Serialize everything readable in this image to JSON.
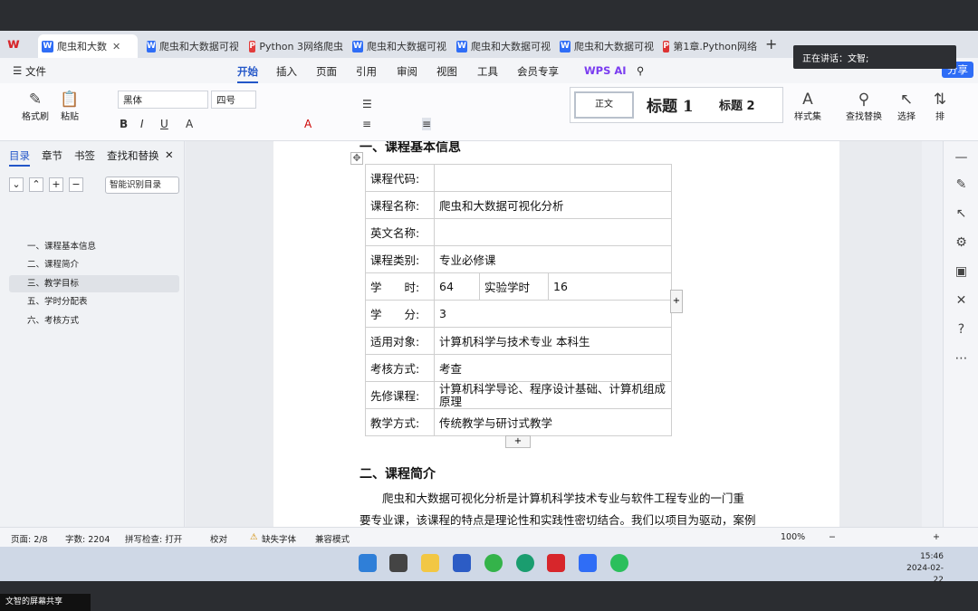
{
  "tabs": [
    {
      "label": "爬虫和大数",
      "icon": "W"
    },
    {
      "label": "爬虫和大数据可视",
      "icon": "W"
    },
    {
      "label": "Python 3网络爬虫",
      "icon": "P"
    },
    {
      "label": "爬虫和大数据可视",
      "icon": "W"
    },
    {
      "label": "爬虫和大数据可视",
      "icon": "W"
    },
    {
      "label": "爬虫和大数据可视",
      "icon": "W"
    },
    {
      "label": "第1章.Python网络",
      "icon": "P"
    }
  ],
  "notice": "正在讲话：文智;",
  "menu": {
    "file": "文件",
    "items": [
      "开始",
      "插入",
      "页面",
      "引用",
      "审阅",
      "视图",
      "工具",
      "会员专享"
    ],
    "ai": "WPS AI",
    "share": "分享"
  },
  "ribbon": {
    "format_painter": "格式刷",
    "paste": "粘贴",
    "font": "黑体",
    "size": "四号",
    "style_normal": "正文",
    "style_h1": "标题 1",
    "style_h2": "标题 2",
    "style_set": "样式集",
    "find_replace": "查找替换",
    "select": "选择",
    "arrange": "排"
  },
  "leftpane": {
    "tabs": [
      "目录",
      "章节",
      "书签",
      "查找和替换"
    ],
    "smart_button": "智能识别目录",
    "toc": [
      "一、课程基本信息",
      "二、课程简介",
      "三、教学目标",
      "五、学时分配表",
      "六、考核方式"
    ]
  },
  "doc": {
    "heading1": "一、课程基本信息",
    "rows": [
      {
        "label": "课程代码:",
        "value": ""
      },
      {
        "label": "课程名称:",
        "value": "爬虫和大数据可视化分析"
      },
      {
        "label": "英文名称:",
        "value": ""
      },
      {
        "label": "课程类别:",
        "value": "专业必修课"
      },
      {
        "label": "学　　时:",
        "value": "64",
        "label2": "实验学时",
        "value2": "16"
      },
      {
        "label": "学　　分:",
        "value": "3"
      },
      {
        "label": "适用对象:",
        "value": "计算机科学与技术专业 本科生"
      },
      {
        "label": "考核方式:",
        "value": "考查"
      },
      {
        "label": "先修课程:",
        "value": "计算机科学导论、程序设计基础、计算机组成原理"
      },
      {
        "label": "教学方式:",
        "value": "传统教学与研讨式教学"
      }
    ],
    "heading2": "二、课程简介",
    "para1": "爬虫和大数据可视化分析是计算机科学技术专业与软件工程专业的一门重",
    "para2": "要专业课，该课程的特点是理论性和实践性密切结合。我们以项目为驱动，案例"
  },
  "status": {
    "page": "页面: 2/8",
    "words": "字数: 2204",
    "spell": "拼写检查: 打开",
    "proof": "校对",
    "missing_font": "缺失字体",
    "compat": "兼容模式",
    "zoom": "100%"
  },
  "taskbar": {
    "time": "15:46",
    "date": "2024-02-22"
  },
  "bottom_label": "文智的屏幕共享"
}
